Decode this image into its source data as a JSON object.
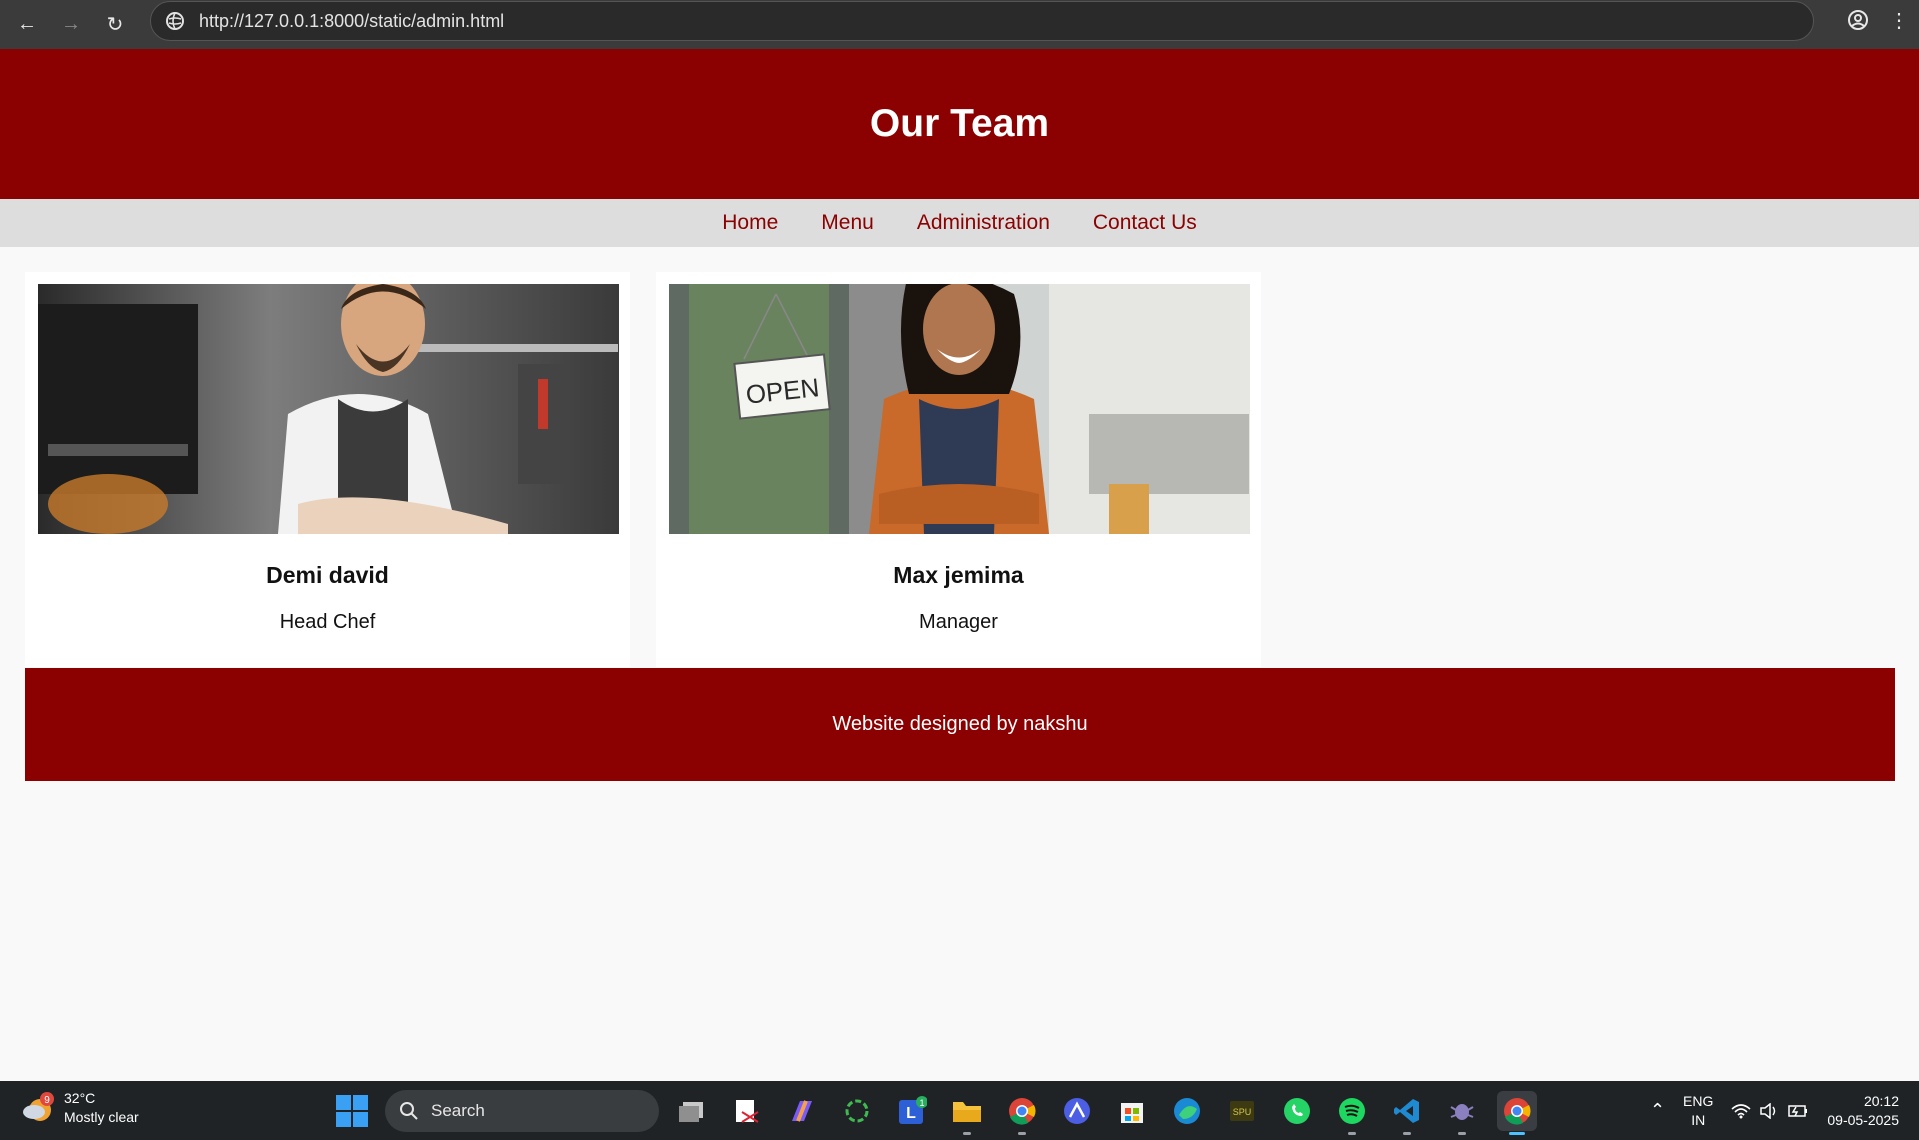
{
  "browser": {
    "url": "http://127.0.0.1:8000/static/admin.html"
  },
  "header": {
    "title": "Our Team"
  },
  "nav": {
    "items": [
      {
        "label": "Home"
      },
      {
        "label": "Menu"
      },
      {
        "label": "Administration"
      },
      {
        "label": "Contact Us"
      }
    ]
  },
  "team": [
    {
      "name": "Demi david",
      "role": "Head Chef",
      "photo": "chef-in-kitchen-photo"
    },
    {
      "name": "Max jemima",
      "role": "Manager",
      "photo": "manager-at-restaurant-door-photo",
      "sign_text": "OPEN"
    }
  ],
  "footer": {
    "text": "Website designed by nakshu"
  },
  "colors": {
    "brand": "#8b0000",
    "nav_bg": "#dddddd",
    "page_bg": "#f9f9f9"
  },
  "taskbar": {
    "weather": {
      "temp": "32°C",
      "condition": "Mostly clear",
      "badge": "9"
    },
    "search_placeholder": "Search",
    "language": {
      "line1": "ENG",
      "line2": "IN"
    },
    "time": "20:12",
    "date": "09-05-2025",
    "badge_count": "1"
  }
}
